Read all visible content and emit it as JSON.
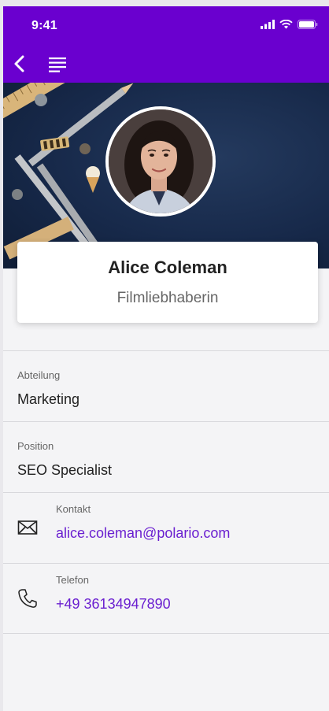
{
  "status_bar": {
    "time": "9:41",
    "icons": [
      "signal-icon",
      "wifi-icon",
      "battery-icon"
    ]
  },
  "nav": {
    "back_icon": "chevron-left-icon",
    "menu_icon": "menu-icon"
  },
  "profile": {
    "name": "Alice Coleman",
    "subtitle": "Filmliebhaberin"
  },
  "details": [
    {
      "label": "Abteilung",
      "value": "Marketing"
    },
    {
      "label": "Position",
      "value": "SEO Specialist"
    },
    {
      "label": "Kontakt",
      "value": "alice.coleman@polario.com",
      "icon": "mail-icon"
    },
    {
      "label": "Telefon",
      "value": "+49 36134947890",
      "icon": "phone-icon"
    }
  ],
  "colors": {
    "brand": "#6a00cf",
    "link": "#6a1fd0",
    "hero": "#17294a"
  }
}
